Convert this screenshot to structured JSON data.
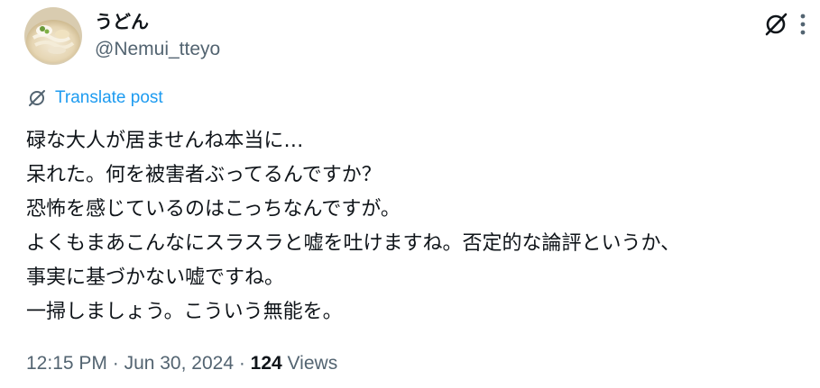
{
  "author": {
    "display_name": "うどん",
    "handle": "@Nemui_tteyo"
  },
  "translate": {
    "label": "Translate post"
  },
  "post": {
    "lines": [
      "碌な大人が居ませんね本当に…",
      "呆れた。何を被害者ぶってるんですか？",
      "恐怖を感じているのはこっちなんですが。",
      "よくもまあこんなにスラスラと嘘を吐けますね。否定的な論評というか、",
      "事実に基づかない嘘ですね。",
      "一掃しましょう。こういう無能を。"
    ]
  },
  "meta": {
    "time": "12:15 PM",
    "sep1": " · ",
    "date": "Jun 30, 2024",
    "sep2": " · ",
    "views_count": "124",
    "views_label": " Views"
  },
  "icons": {
    "grok": "grok-icon",
    "more": "more-options-icon",
    "translate": "translate-icon"
  },
  "colors": {
    "link": "#1d9bf0",
    "secondary_text": "#536471",
    "primary_text": "#0f1419"
  }
}
